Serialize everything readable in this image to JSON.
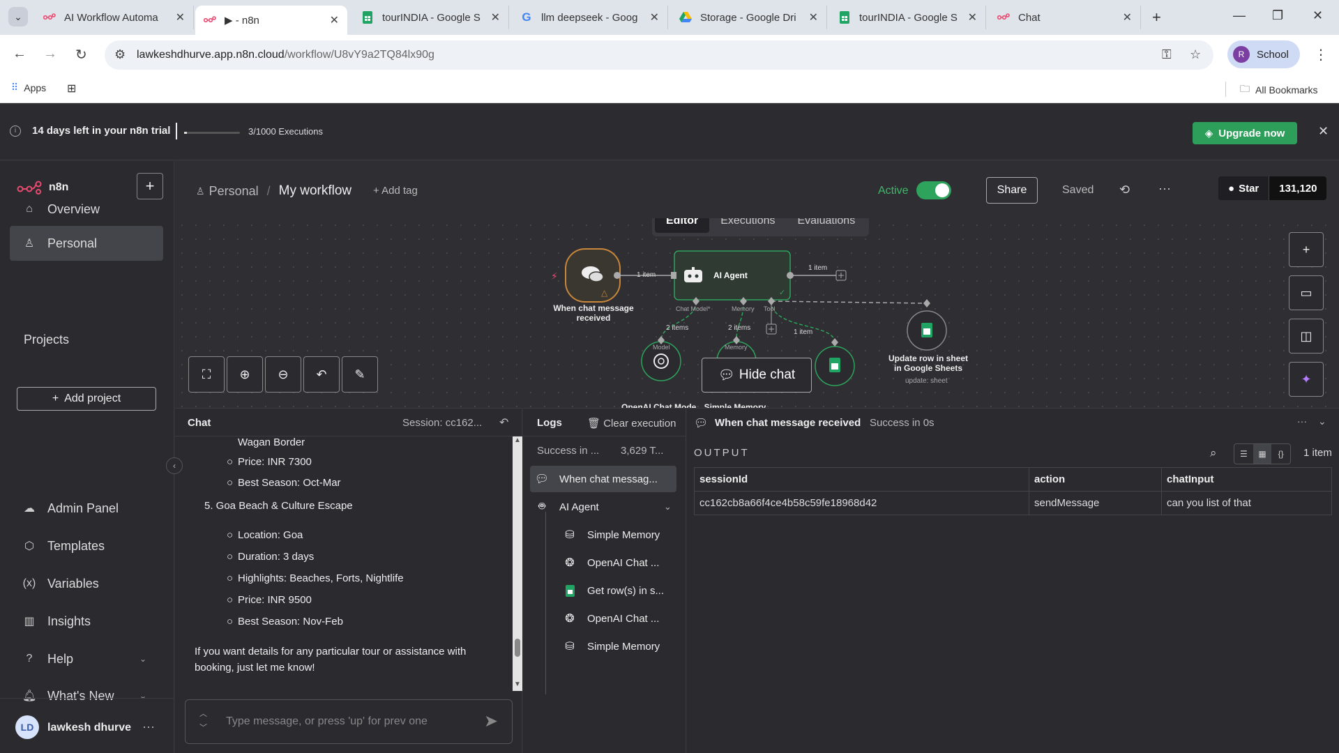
{
  "browser": {
    "tabs": [
      {
        "title": "AI Workflow Automa",
        "icon": "n8n-icon",
        "active": false
      },
      {
        "title": "▶ - n8n",
        "icon": "n8n-icon",
        "active": true
      },
      {
        "title": "tourINDIA - Google S",
        "icon": "google-sheets-icon",
        "active": false
      },
      {
        "title": "llm deepseek - Goog",
        "icon": "google-icon",
        "active": false
      },
      {
        "title": "Storage - Google Dri",
        "icon": "google-drive-icon",
        "active": false
      },
      {
        "title": "tourINDIA - Google S",
        "icon": "google-sheets-icon",
        "active": false
      },
      {
        "title": "Chat",
        "icon": "n8n-icon",
        "active": false
      }
    ],
    "url_host": "lawkeshdhurve.app.n8n.cloud",
    "url_path": "/workflow/U8vY9a2TQ84lx90g",
    "profile_initial": "R",
    "profile_label": "School",
    "bookmarks": {
      "apps": "Apps",
      "all": "All Bookmarks"
    }
  },
  "banner": {
    "trial_text": "14 days left in your n8n trial",
    "executions": "3/1000 Executions",
    "upgrade_label": "Upgrade now",
    "executions_used_fraction": 0.003
  },
  "sidebar": {
    "logo": "n8n",
    "nav": [
      {
        "label": "Overview",
        "icon": "home-icon"
      },
      {
        "label": "Personal",
        "icon": "user-icon",
        "selected": true
      }
    ],
    "projects_heading": "Projects",
    "add_project": "Add project",
    "bottom_nav": [
      {
        "label": "Admin Panel",
        "icon": "cloud-icon"
      },
      {
        "label": "Templates",
        "icon": "templates-icon"
      },
      {
        "label": "Variables",
        "icon": "variables-icon"
      },
      {
        "label": "Insights",
        "icon": "insights-icon"
      },
      {
        "label": "Help",
        "icon": "help-icon"
      },
      {
        "label": "What's New",
        "icon": "bell-icon"
      }
    ],
    "user": {
      "initials": "LD",
      "name": "lawkesh dhurve"
    }
  },
  "header": {
    "project": "Personal",
    "workflow": "My workflow",
    "add_tag": "+ Add tag",
    "active_label": "Active",
    "share": "Share",
    "saved": "Saved",
    "github_star": "Star",
    "github_count": "131,120"
  },
  "canvas": {
    "tabs": [
      "Editor",
      "Executions",
      "Evaluations"
    ],
    "selected_tab": "Editor",
    "hide_chat": "Hide chat",
    "nodes": {
      "trigger": "When chat message received",
      "agent": "AI Agent",
      "sheets_update_1": "Update row in sheet",
      "sheets_update_2": "in Google Sheets",
      "sheets_update_sub": "update: sheet",
      "openai": "OpenAI Chat Model",
      "memory": "Simple Memory"
    },
    "edges": {
      "trigger_agent": "1 item",
      "agent_out": "1 item",
      "model": "2 items",
      "memory": "2 items",
      "tool": "1 item"
    },
    "ports": {
      "chat_model": "Chat Model*",
      "memory": "Memory",
      "tool": "Tool",
      "model": "Model",
      "memory2": "Memory"
    }
  },
  "chat": {
    "title": "Chat",
    "session": "Session: cc162...",
    "lines": {
      "l0": "Wagan Border",
      "l1": "Price: INR 7300",
      "l2": "Best Season: Oct-Mar",
      "h5": "5. Goa Beach & Culture Escape",
      "l3": "Location: Goa",
      "l4": "Duration: 3 days",
      "l5": "Highlights: Beaches, Forts, Nightlife",
      "l6": "Price: INR 9500",
      "l7": "Best Season: Nov-Feb",
      "p1": "If you want details for any particular tour or assistance with",
      "p2": "booking, just let me know!"
    },
    "input_placeholder": "Type message, or press 'up' for prev one"
  },
  "logs": {
    "title": "Logs",
    "clear": "Clear execution",
    "summary_status": "Success in ...",
    "summary_tokens": "3,629 T...",
    "items": [
      {
        "label": "When chat messag...",
        "icon": "chat-icon"
      },
      {
        "label": "AI Agent",
        "icon": "robot-icon"
      },
      {
        "label": "Simple Memory",
        "icon": "database-icon"
      },
      {
        "label": "OpenAI Chat ...",
        "icon": "openai-icon"
      },
      {
        "label": "Get row(s) in s...",
        "icon": "google-sheets-icon"
      },
      {
        "label": "OpenAI Chat ...",
        "icon": "openai-icon"
      },
      {
        "label": "Simple Memory",
        "icon": "database-icon"
      }
    ]
  },
  "output": {
    "node_name": "When chat message received",
    "status": "Success in 0s",
    "label": "OUTPUT",
    "items_count": "1 item",
    "columns": [
      "sessionId",
      "action",
      "chatInput"
    ],
    "rows": [
      [
        "cc162cb8a66f4ce4b58c59fe18968d42",
        "sendMessage",
        "can you list of that"
      ]
    ]
  },
  "colors": {
    "accent_green": "#2ea35c",
    "n8n_pink": "#ea4b71",
    "trigger_orange": "#c8873a",
    "sheets_green": "#1fa463"
  }
}
